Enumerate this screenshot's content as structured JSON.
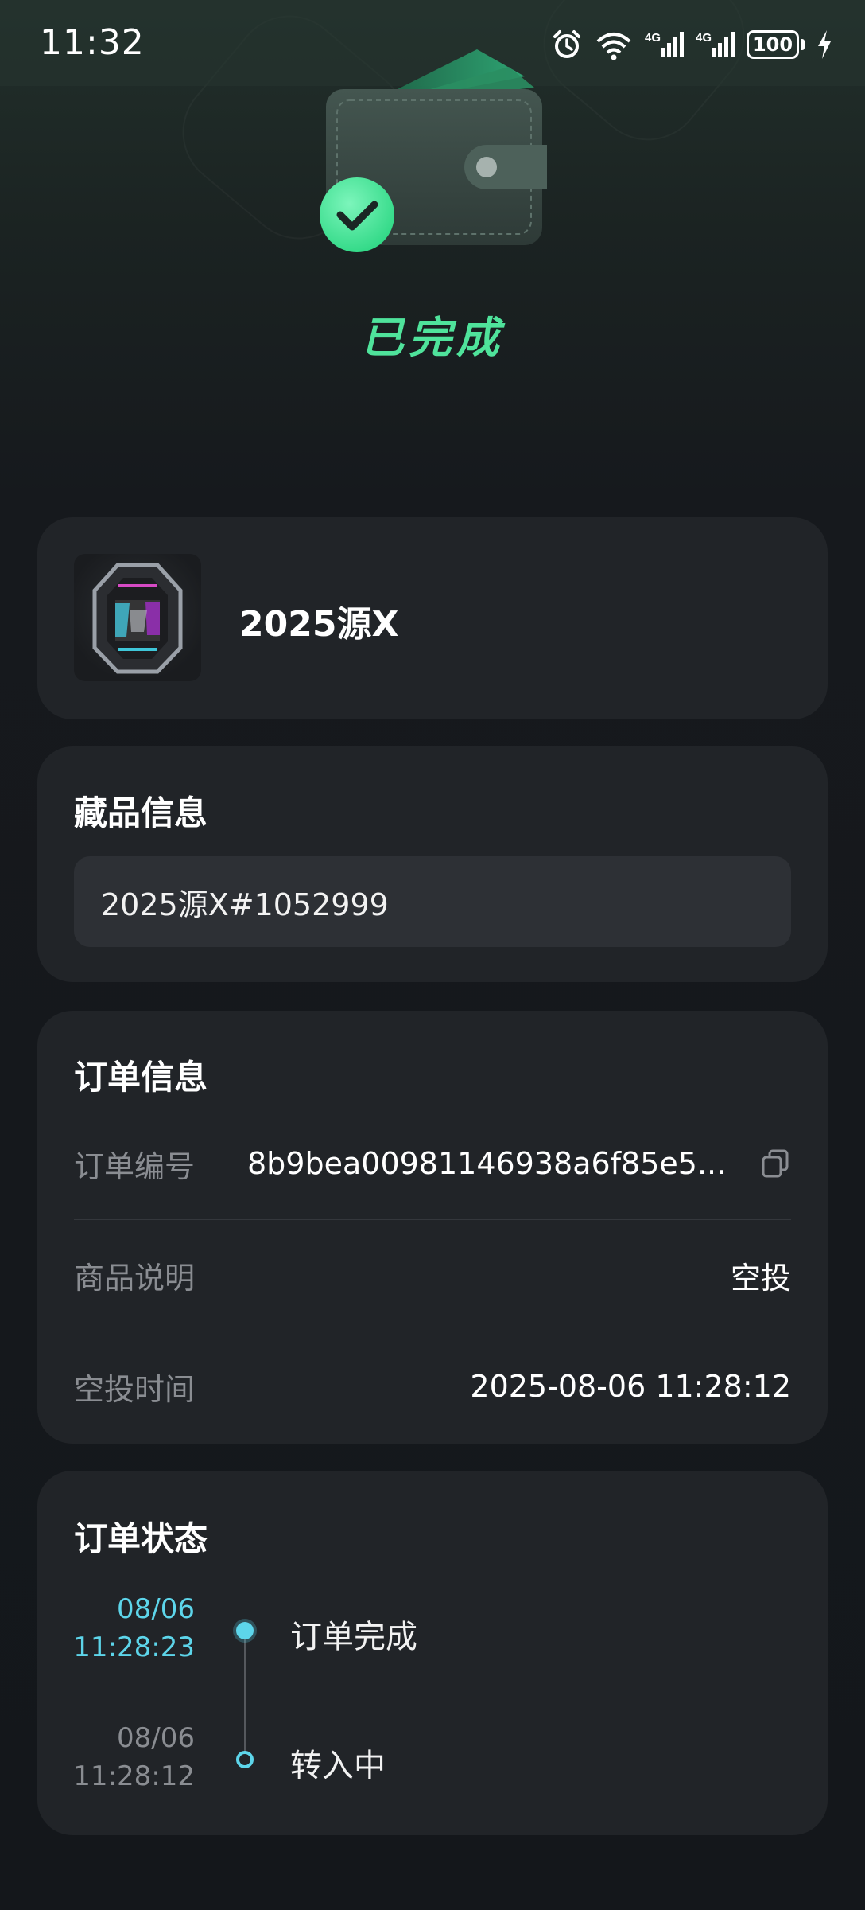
{
  "status_bar": {
    "time": "11:32",
    "icons": [
      "alarm-icon",
      "wifi-icon",
      "signal-4g-icon",
      "signal-4g-icon",
      "battery-icon",
      "charging-icon"
    ],
    "battery_level": "100"
  },
  "hero": {
    "status_text": "已完成",
    "accent_color": "#4fe39b"
  },
  "product": {
    "name": "2025源X"
  },
  "collection_info": {
    "title": "藏品信息",
    "item": "2025源X#1052999"
  },
  "order_info": {
    "title": "订单信息",
    "rows": [
      {
        "label": "订单编号",
        "value": "8b9bea00981146938a6f85e5..."
      },
      {
        "label": "商品说明",
        "value": "空投"
      },
      {
        "label": "空投时间",
        "value": "2025-08-06 11:28:12"
      }
    ]
  },
  "order_status": {
    "title": "订单状态",
    "timeline": [
      {
        "date": "08/06",
        "time": "11:28:23",
        "text": "订单完成",
        "active": true
      },
      {
        "date": "08/06",
        "time": "11:28:12",
        "text": "转入中",
        "active": false
      }
    ],
    "active_color": "#5dd5ea"
  }
}
